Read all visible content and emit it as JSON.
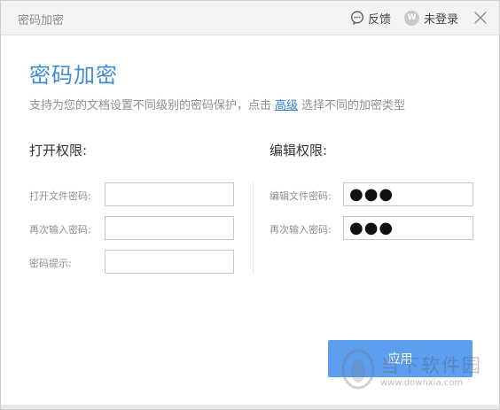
{
  "window": {
    "title": "密码加密",
    "feedback_label": "反馈",
    "account_label": "未登录",
    "avatar_glyph": "W"
  },
  "header": {
    "title": "密码加密",
    "subtitle_before": "支持为您的文档设置不同级别的密码保护，点击",
    "subtitle_link": "高级",
    "subtitle_after": "选择不同的加密类型"
  },
  "open_permission": {
    "section_title": "打开权限:",
    "fields": [
      {
        "label": "打开文件密码:",
        "value": ""
      },
      {
        "label": "再次输入密码:",
        "value": ""
      },
      {
        "label": "密码提示:",
        "value": ""
      }
    ]
  },
  "edit_permission": {
    "section_title": "编辑权限:",
    "fields": [
      {
        "label": "编辑文件密码:",
        "value": "●●●"
      },
      {
        "label": "再次输入密码:",
        "value": "●●●"
      }
    ]
  },
  "actions": {
    "apply_label": "应用"
  },
  "watermark": {
    "text": "当下软件园",
    "url": "www.downxia.com"
  },
  "colors": {
    "accent": "#3d8cd8",
    "link": "#2f7fd0",
    "button": "#5c9ff0"
  },
  "icons": {
    "feedback": "speech-bubble-icon",
    "close": "close-icon",
    "avatar": "avatar-icon"
  }
}
